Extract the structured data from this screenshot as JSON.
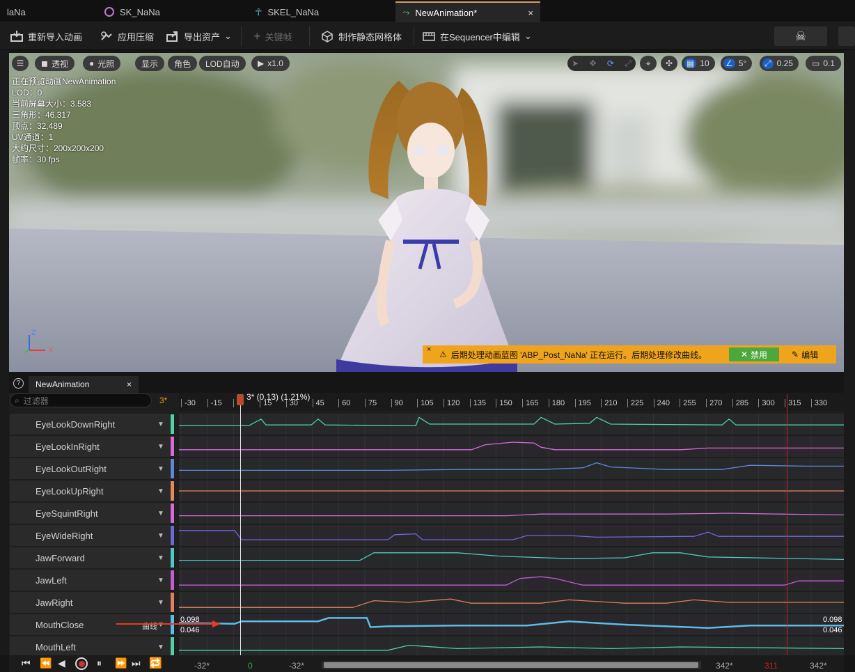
{
  "tabs": [
    {
      "label": "laNa"
    },
    {
      "label": "SK_NaNa"
    },
    {
      "label": "SKEL_NaNa"
    },
    {
      "label": "NewAnimation*",
      "close": "×"
    }
  ],
  "toolbar": {
    "reimport": "重新导入动画",
    "compress": "应用压缩",
    "export": "导出资产",
    "keyframe": "关键帧",
    "static_mesh": "制作静态网格体",
    "sequencer": "在Sequencer中编辑"
  },
  "viewport": {
    "perspective": "透视",
    "lit": "光照",
    "show": "显示",
    "character": "角色",
    "lod": "LOD自动",
    "speed": "x1.0",
    "grid_size": "10",
    "rotation_snap": "5°",
    "scale_snap": "0.25",
    "camera_speed": "0.1",
    "axis_z": "Z",
    "axis_x": "X",
    "stats": [
      "正在预览动画NewAnimation",
      "LOD：0",
      "当前屏幕大小：3.583",
      "三角形：46,317",
      "顶点：32,489",
      "UV通道：1",
      "大约尺寸：200x200x200",
      "帧率：30 fps"
    ],
    "notice": {
      "text": "后期处理动画蓝图 'ABP_Post_NaNa' 正在运行。后期处理修改曲线。",
      "disable": "禁用",
      "edit": "编辑",
      "close": "×"
    }
  },
  "editor_tab": {
    "label": "NewAnimation",
    "close": "×"
  },
  "filter": {
    "placeholder": "过滤器",
    "frame": "3*"
  },
  "playhead": "3* (0.13) (1.21%)",
  "ruler_ticks": [
    "-30",
    "-15",
    "0",
    "15",
    "30",
    "45",
    "60",
    "75",
    "90",
    "105",
    "120",
    "135",
    "150",
    "165",
    "180",
    "195",
    "210",
    "225",
    "240",
    "255",
    "270",
    "285",
    "300",
    "315",
    "330"
  ],
  "tracks": [
    {
      "name": "EyeLookDownRight",
      "color": "#4fd3a6"
    },
    {
      "name": "EyeLookInRight",
      "color": "#d66ad6"
    },
    {
      "name": "EyeLookOutRight",
      "color": "#5f86d8"
    },
    {
      "name": "EyeLookUpRight",
      "color": "#e28a5c"
    },
    {
      "name": "EyeSquintRight",
      "color": "#d66ad6"
    },
    {
      "name": "EyeWideRight",
      "color": "#6c6ad8"
    },
    {
      "name": "JawForward",
      "color": "#4fc9c0"
    },
    {
      "name": "JawLeft",
      "color": "#c55cd0"
    },
    {
      "name": "JawRight",
      "color": "#e08060"
    },
    {
      "name": "MouthClose",
      "color": "#5bbde8"
    },
    {
      "name": "MouthLeft",
      "color": "#4fd3a6"
    }
  ],
  "mouthclose": {
    "max": "0.098",
    "min": "0.046",
    "label": "曲线"
  },
  "bottom": {
    "start": "-32*",
    "current": "0",
    "view_start": "-32*",
    "view_end": "342*",
    "end_red": "311",
    "end": "342*"
  }
}
